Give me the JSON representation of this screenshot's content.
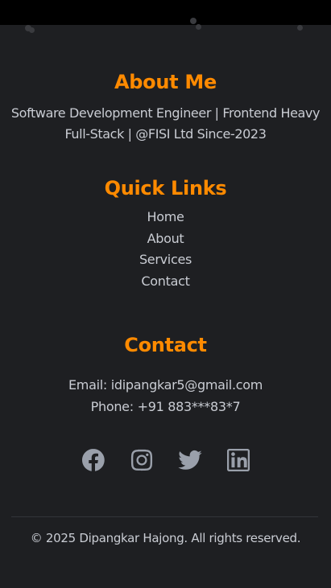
{
  "about": {
    "title": "About Me",
    "line1": "Software Development Engineer | Frontend Heavy",
    "line2": "Full-Stack | @FISI Ltd Since-2023"
  },
  "quick_links": {
    "title": "Quick Links",
    "items": [
      "Home",
      "About",
      "Services",
      "Contact"
    ]
  },
  "contact": {
    "title": "Contact",
    "email": "Email: idipangkar5@gmail.com",
    "phone": "Phone: +91 883***83*7"
  },
  "social": [
    "facebook-icon",
    "instagram-icon",
    "twitter-icon",
    "linkedin-icon"
  ],
  "footer": {
    "copyright": "© 2025 Dipangkar Hajong. All rights reserved."
  },
  "colors": {
    "background": "#1e1f22",
    "accent": "#ff8a00",
    "text": "#c9ccd3",
    "icon": "#9aa0ab"
  }
}
